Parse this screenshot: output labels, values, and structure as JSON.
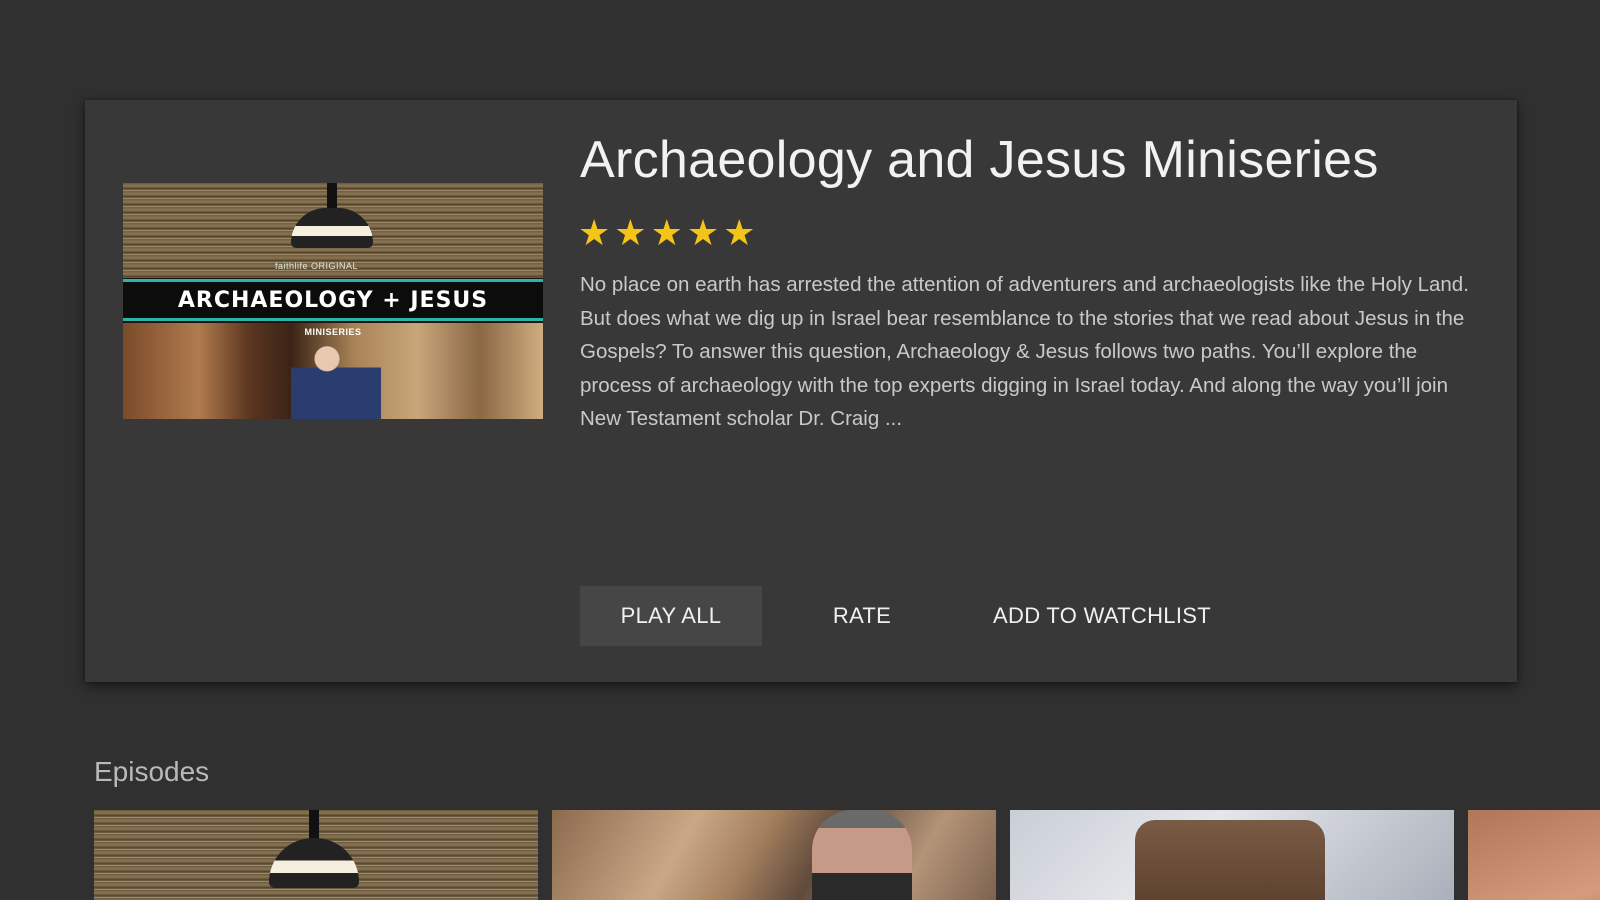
{
  "show": {
    "title": "Archaeology and Jesus Miniseries",
    "rating": 5,
    "rating_max": 5,
    "star_color": "#f5c418",
    "description": "No place on earth has arrested the attention of adventurers and archaeologists like the Holy Land. But does what we dig up in Israel bear resemblance to the stories that we read about Jesus in the Gospels? To answer this question, Archaeology & Jesus follows two paths. You’ll explore the process of archaeology with the top experts digging in Israel today. And along the way you’ll join New Testament scholar Dr. Craig ...",
    "poster": {
      "brand": "faithlife ORIGINAL",
      "band_text": "ARCHAEOLOGY + JESUS",
      "sub_text": "MINISERIES"
    }
  },
  "actions": {
    "play_all": "PLAY ALL",
    "rate": "RATE",
    "add_to_watchlist": "ADD TO WATCHLIST"
  },
  "episodes": {
    "section_title": "Episodes"
  }
}
